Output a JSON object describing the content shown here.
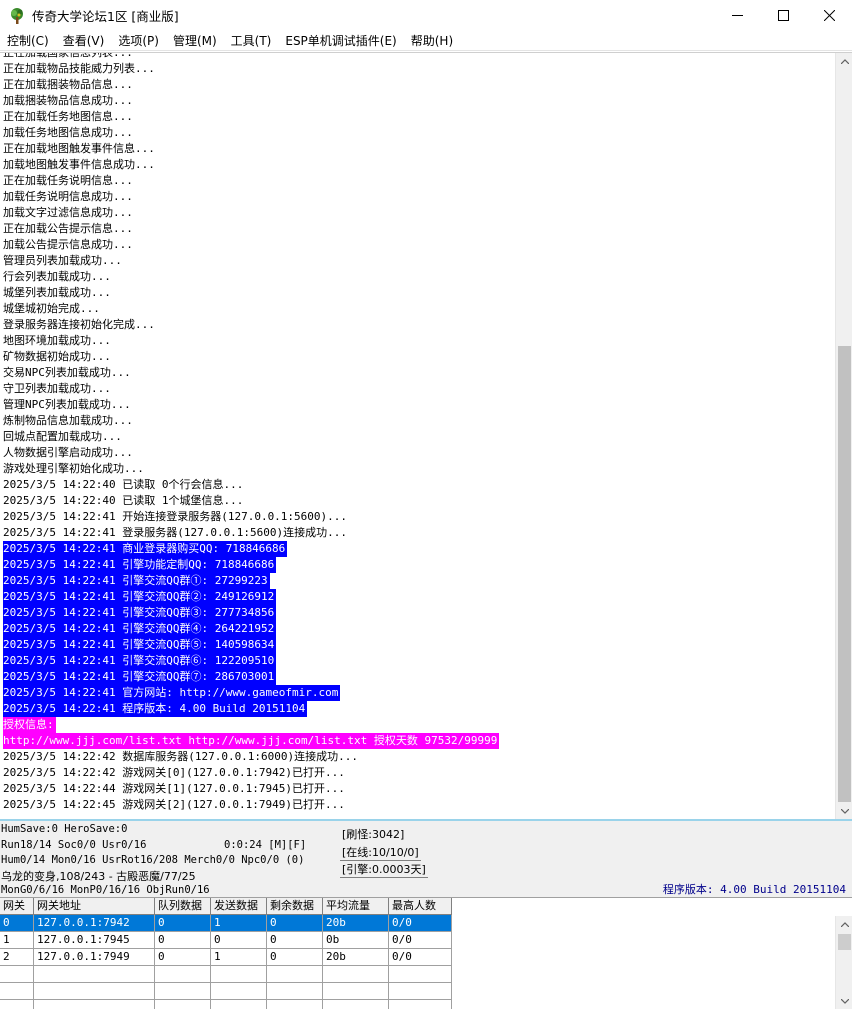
{
  "window": {
    "title": "传奇大学论坛1区 [商业版]",
    "icon": "tree-app-icon"
  },
  "menu": [
    "控制(C)",
    "查看(V)",
    "选项(P)",
    "管理(M)",
    "工具(T)",
    "ESP单机调试插件(E)",
    "帮助(H)"
  ],
  "log": [
    {
      "text": "正在加载国家信息列表...",
      "hl": ""
    },
    {
      "text": "正在加载物品技能威力列表...",
      "hl": ""
    },
    {
      "text": "正在加载捆装物品信息...",
      "hl": ""
    },
    {
      "text": "加载捆装物品信息成功...",
      "hl": ""
    },
    {
      "text": "正在加载任务地图信息...",
      "hl": ""
    },
    {
      "text": "加载任务地图信息成功...",
      "hl": ""
    },
    {
      "text": "正在加载地图触发事件信息...",
      "hl": ""
    },
    {
      "text": "加载地图触发事件信息成功...",
      "hl": ""
    },
    {
      "text": "正在加载任务说明信息...",
      "hl": ""
    },
    {
      "text": "加载任务说明信息成功...",
      "hl": ""
    },
    {
      "text": "加载文字过滤信息成功...",
      "hl": ""
    },
    {
      "text": "正在加载公告提示信息...",
      "hl": ""
    },
    {
      "text": "加载公告提示信息成功...",
      "hl": ""
    },
    {
      "text": "管理员列表加载成功...",
      "hl": ""
    },
    {
      "text": "行会列表加载成功...",
      "hl": ""
    },
    {
      "text": "城堡列表加载成功...",
      "hl": ""
    },
    {
      "text": "城堡城初始完成...",
      "hl": ""
    },
    {
      "text": "登录服务器连接初始化完成...",
      "hl": ""
    },
    {
      "text": "地图环境加载成功...",
      "hl": ""
    },
    {
      "text": "矿物数据初始成功...",
      "hl": ""
    },
    {
      "text": "交易NPC列表加载成功...",
      "hl": ""
    },
    {
      "text": "守卫列表加载成功...",
      "hl": ""
    },
    {
      "text": "管理NPC列表加载成功...",
      "hl": ""
    },
    {
      "text": "炼制物品信息加载成功...",
      "hl": ""
    },
    {
      "text": "回城点配置加载成功...",
      "hl": ""
    },
    {
      "text": "人物数据引擎启动成功...",
      "hl": ""
    },
    {
      "text": "游戏处理引擎初始化成功...",
      "hl": ""
    },
    {
      "text": "2025/3/5 14:22:40 已读取 0个行会信息...",
      "hl": ""
    },
    {
      "text": "2025/3/5 14:22:40 已读取 1个城堡信息...",
      "hl": ""
    },
    {
      "text": "2025/3/5 14:22:41 开始连接登录服务器(127.0.0.1:5600)...",
      "hl": ""
    },
    {
      "text": "2025/3/5 14:22:41 登录服务器(127.0.0.1:5600)连接成功...",
      "hl": ""
    },
    {
      "text": "2025/3/5 14:22:41 商业登录器购买QQ: 718846686",
      "hl": "blue"
    },
    {
      "text": "2025/3/5 14:22:41 引擎功能定制QQ: 718846686",
      "hl": "blue"
    },
    {
      "text": "2025/3/5 14:22:41 引擎交流QQ群①: 27299223",
      "hl": "blue"
    },
    {
      "text": "2025/3/5 14:22:41 引擎交流QQ群②: 249126912",
      "hl": "blue"
    },
    {
      "text": "2025/3/5 14:22:41 引擎交流QQ群③: 277734856",
      "hl": "blue"
    },
    {
      "text": "2025/3/5 14:22:41 引擎交流QQ群④: 264221952",
      "hl": "blue"
    },
    {
      "text": "2025/3/5 14:22:41 引擎交流QQ群⑤: 140598634",
      "hl": "blue"
    },
    {
      "text": "2025/3/5 14:22:41 引擎交流QQ群⑥: 122209510",
      "hl": "blue"
    },
    {
      "text": "2025/3/5 14:22:41 引擎交流QQ群⑦: 286703001",
      "hl": "blue"
    },
    {
      "text": "2025/3/5 14:22:41 官方网站: http://www.gameofmir.com",
      "hl": "blue"
    },
    {
      "text": "2025/3/5 14:22:41 程序版本: 4.00 Build 20151104",
      "hl": "blue"
    },
    {
      "text": "授权信息:",
      "hl": "magenta"
    },
    {
      "text": "http://www.jjj.com/list.txt http://www.jjj.com/list.txt 授权天数 97532/99999",
      "hl": "magenta"
    },
    {
      "text": "2025/3/5 14:22:42 数据库服务器(127.0.0.1:6000)连接成功...",
      "hl": ""
    },
    {
      "text": "2025/3/5 14:22:42 游戏网关[0](127.0.0.1:7942)已打开...",
      "hl": ""
    },
    {
      "text": "2025/3/5 14:22:44 游戏网关[1](127.0.0.1:7945)已打开...",
      "hl": ""
    },
    {
      "text": "2025/3/5 14:22:45 游戏网关[2](127.0.0.1:7949)已打开...",
      "hl": ""
    }
  ],
  "status": {
    "save": "HumSave:0 HeroSave:0",
    "run": "Run18/14 Soc0/0 Usr0/16",
    "time": "0:0:24 [M][F]",
    "hum": "Hum0/14 Mon0/16 UsrRot16/208 Merch0/0 Npc0/0 (0)",
    "map": "乌龙的变身,108/243 - 古殿恶魔/77/25",
    "mon": "MonG0/6/16 MonP0/16/16 ObjRun0/16",
    "refresh": "[刷怪:3042]",
    "online": "[在线:10/10/0]",
    "engine": "[引擎:0.0003天]",
    "version": "程序版本: 4.00 Build 20151104"
  },
  "table": {
    "headers": [
      "网关",
      "网关地址",
      "队列数据",
      "发送数据",
      "剩余数据",
      "平均流量",
      "最高人数"
    ],
    "rows": [
      [
        "0",
        "127.0.0.1:7942",
        "0",
        "1",
        "0",
        "20b",
        "0/0"
      ],
      [
        "1",
        "127.0.0.1:7945",
        "0",
        "0",
        "0",
        "0b",
        "0/0"
      ],
      [
        "2",
        "127.0.0.1:7949",
        "0",
        "1",
        "0",
        "20b",
        "0/0"
      ]
    ],
    "selected_row": 0
  }
}
